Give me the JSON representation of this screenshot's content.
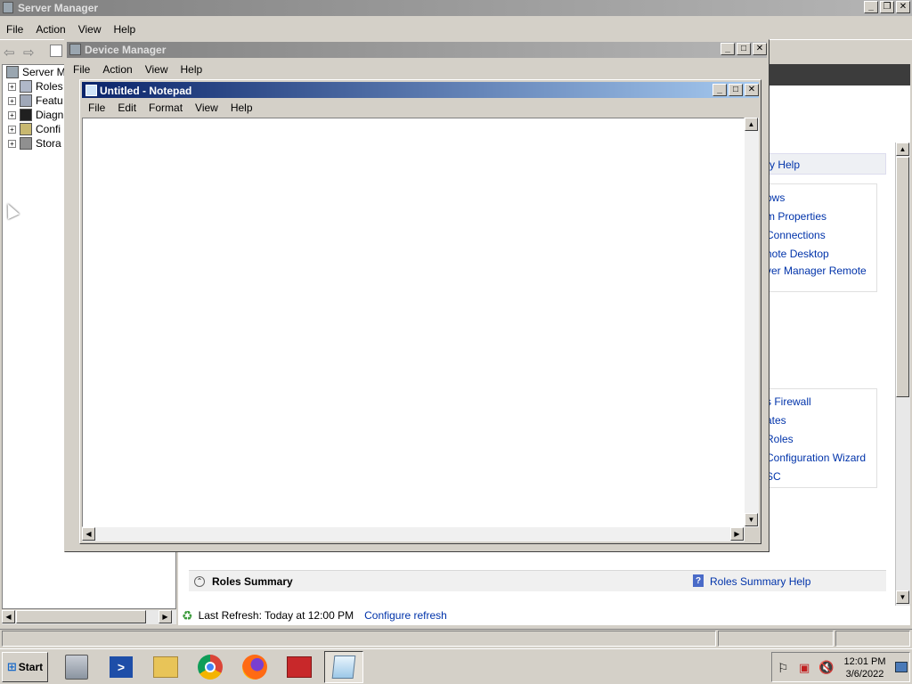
{
  "server_manager": {
    "title": "Server Manager",
    "menu": [
      "File",
      "Action",
      "View",
      "Help"
    ],
    "tree": [
      {
        "label": "Server Ma"
      },
      {
        "label": "Roles"
      },
      {
        "label": "Featu"
      },
      {
        "label": "Diagn"
      },
      {
        "label": "Confi"
      },
      {
        "label": "Stora"
      }
    ],
    "right_links_top": [
      "ry Help"
    ],
    "right_links_group1": [
      "ows",
      "m Properties",
      "Connections",
      "note Desktop",
      "ver Manager Remote"
    ],
    "right_links_group2": [
      "s Firewall",
      "ates",
      "Roles",
      "Configuration Wizard",
      "SC"
    ],
    "roles_summary": {
      "title": "Roles Summary",
      "help": "Roles Summary Help"
    },
    "refresh": {
      "text": "Last Refresh: Today at 12:00 PM",
      "link": "Configure refresh"
    }
  },
  "device_manager": {
    "title": "Device Manager",
    "menu": [
      "File",
      "Action",
      "View",
      "Help"
    ]
  },
  "notepad": {
    "title": "Untitled - Notepad",
    "menu": [
      "File",
      "Edit",
      "Format",
      "View",
      "Help"
    ],
    "content": ""
  },
  "taskbar": {
    "start_label": "Start",
    "apps": [
      "server-manager-icon",
      "powershell-icon",
      "explorer-icon",
      "chrome-icon",
      "firefox-icon",
      "toolbox-icon",
      "notepad-icon"
    ],
    "clock_time": "12:01 PM",
    "clock_date": "3/6/2022"
  }
}
